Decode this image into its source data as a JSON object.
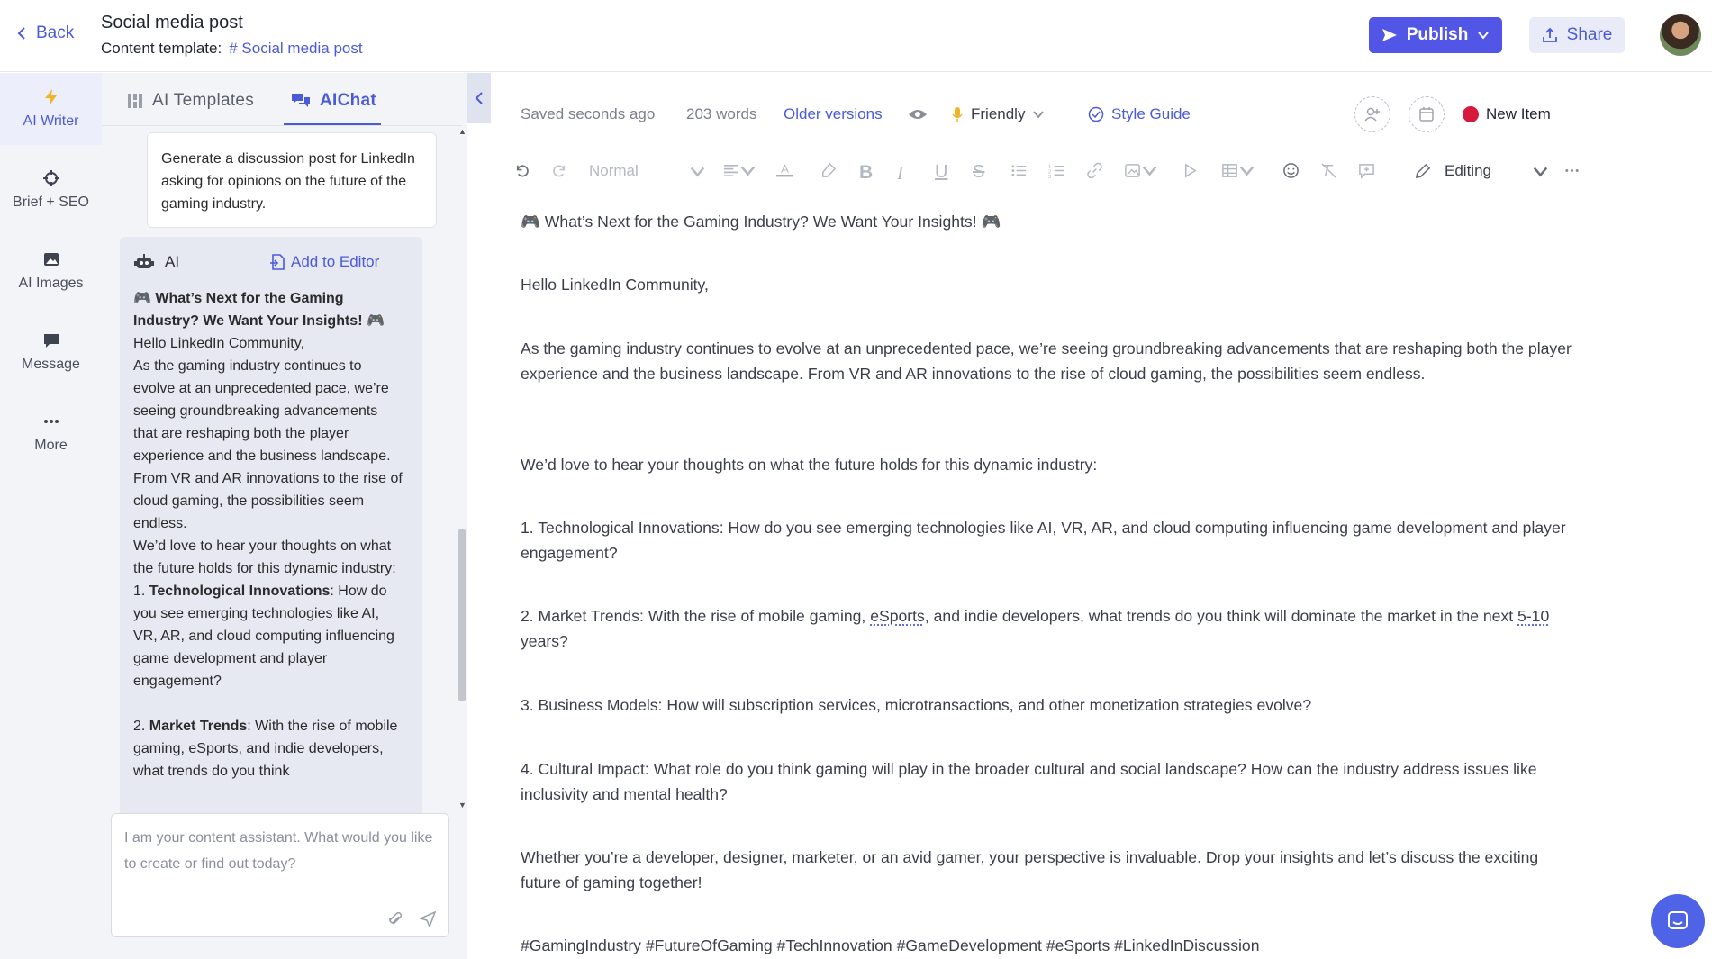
{
  "header": {
    "back_label": "Back",
    "title": "Social media post",
    "template_label": "Content template:",
    "template_hash": "#",
    "template_name": "Social media post",
    "publish_label": "Publish",
    "share_label": "Share"
  },
  "rail": {
    "items": [
      {
        "label": "AI Writer",
        "icon": "bolt-icon"
      },
      {
        "label": "Brief + SEO",
        "icon": "crosshair-icon"
      },
      {
        "label": "AI Images",
        "icon": "image-icon"
      },
      {
        "label": "Message",
        "icon": "message-icon"
      },
      {
        "label": "More",
        "icon": "more-icon"
      }
    ]
  },
  "chat": {
    "tabs": [
      {
        "label": "AI Templates",
        "icon": "grid-icon"
      },
      {
        "label": "AIChat",
        "icon": "chat-icon"
      }
    ],
    "user_message": "Generate a discussion post for LinkedIn asking for opinions on the future of the gaming industry.",
    "ai_label": "AI",
    "add_to_editor": "Add to Editor",
    "ai_response": {
      "heading": "What’s Next for the Gaming Industry? We Want Your Insights!",
      "greeting": "Hello LinkedIn Community,",
      "intro": "As the gaming industry continues to evolve at an unprecedented pace, we’re seeing groundbreaking advancements that are reshaping both the player experience and the business landscape. From VR and AR innovations to the rise of cloud gaming, the possibilities seem endless.",
      "ask": "We’d love to hear your thoughts on what the future holds for this dynamic industry:",
      "p1_num": "1. ",
      "p1_bold": "Technological Innovations",
      "p1_rest": ": How do you see emerging technologies like AI, VR, AR, and cloud computing influencing game development and player engagement?",
      "p2_num": "2. ",
      "p2_bold": "Market Trends",
      "p2_rest": ": With the rise of mobile gaming, eSports, and indie developers, what trends do you think"
    },
    "input_placeholder": "I am your content assistant. What would you like to create or find out today?"
  },
  "meta": {
    "saved": "Saved seconds ago",
    "words": "203 words",
    "older_versions": "Older versions",
    "tone": "Friendly",
    "style_guide": "Style Guide",
    "status": "New Item"
  },
  "toolbar": {
    "paragraph_style": "Normal",
    "mode": "Editing"
  },
  "editor": {
    "heading": "What’s Next for the Gaming Industry? We Want Your Insights!",
    "greeting": "Hello LinkedIn Community,",
    "intro": "As the gaming industry continues to evolve at an unprecedented pace, we’re seeing groundbreaking advancements that are reshaping both the player experience and the business landscape. From VR and AR innovations to the rise of cloud gaming, the possibilities seem endless.",
    "ask": "We’d love to hear your thoughts on what the future holds for this dynamic industry:",
    "p1": "1. Technological Innovations: How do you see emerging technologies like AI, VR, AR, and cloud computing influencing game development and player engagement?",
    "p2_a": "2. Market Trends: With the rise of mobile gaming, ",
    "p2_esports": "eSports",
    "p2_b": ", and indie developers, what trends do you think will dominate the market in the next ",
    "p2_range": "5-10",
    "p2_c": " years?",
    "p3": "3. Business Models: How will subscription services, microtransactions, and other monetization strategies evolve?",
    "p4": "4. Cultural Impact: What role do you think gaming will play in the broader cultural and social landscape? How can the industry address issues like inclusivity and mental health?",
    "closing": "Whether you’re a developer, designer, marketer, or an avid gamer, your perspective is invaluable. Drop your insights and let’s discuss the exciting future of gaming together!",
    "hashtags": "#GamingIndustry #FutureOfGaming #TechInnovation #GameDevelopment #eSports #LinkedInDiscussion"
  },
  "colors": {
    "accent": "#5156e6",
    "link": "#4b5bd8",
    "status_red": "#d8193e"
  }
}
